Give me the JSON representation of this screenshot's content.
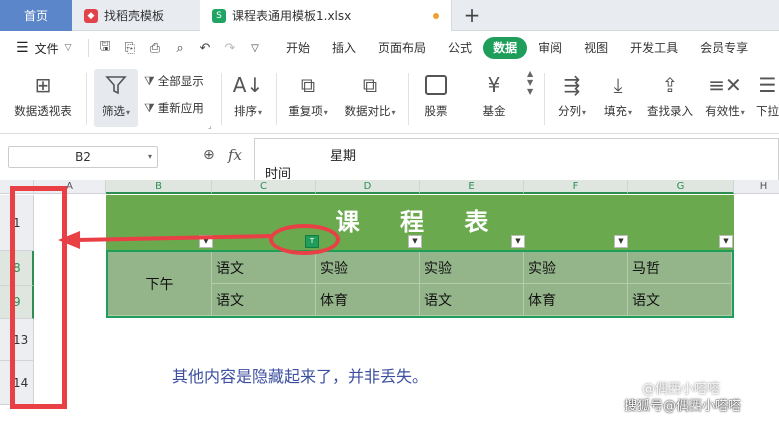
{
  "tabbar": {
    "home": "首页",
    "templates": "找稻壳模板",
    "file": "课程表通用模板1.xlsx",
    "add": "+"
  },
  "menubar": {
    "file_menu": "文件",
    "tabs": [
      "开始",
      "插入",
      "页面布局",
      "公式",
      "数据",
      "审阅",
      "视图",
      "开发工具",
      "会员专享"
    ],
    "active_tab": "数据"
  },
  "ribbon": {
    "pivot": "数据透视表",
    "filter": "筛选",
    "show_all": "全部显示",
    "reapply": "重新应用",
    "sort": "排序",
    "duplicates": "重复项",
    "compare": "数据对比",
    "stock": "股票",
    "fund": "基金",
    "split": "分列",
    "fill": "填充",
    "lookup": "查找录入",
    "validity": "有效性",
    "dropdown": "下拉"
  },
  "formula_bar": {
    "cell_ref": "B2",
    "fx": "fx",
    "content_line1": "星期",
    "content_line2": "时间"
  },
  "sheet": {
    "columns": [
      "A",
      "B",
      "C",
      "D",
      "E",
      "F",
      "G",
      "H"
    ],
    "rows": [
      "1",
      "8",
      "9",
      "13",
      "14"
    ],
    "title": "课 程 表",
    "filter_active_glyph": "T",
    "period": "下午",
    "row8": [
      "语文",
      "实验",
      "实验",
      "实验",
      "马哲"
    ],
    "row9": [
      "语文",
      "体育",
      "语文",
      "体育",
      "语文"
    ],
    "note": "其他内容是隐藏起来了，并非丢失。"
  },
  "watermark": {
    "line1": "@偶西小嗒嗒",
    "line2": "搜狐号@偶西小嗒嗒"
  },
  "colors": {
    "accent": "#1e9e5a",
    "title_bg": "#6aa94e",
    "table_bg": "#94b58a",
    "annotation": "#e94046",
    "note_text": "#3c4fa0"
  }
}
